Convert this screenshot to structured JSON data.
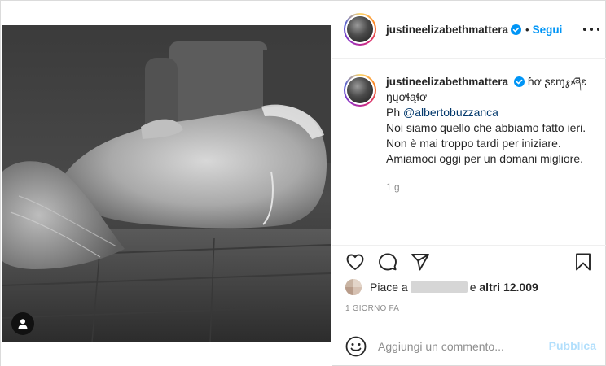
{
  "post": {
    "username": "justineelizabethmattera",
    "follow_label": "Segui",
    "separator": "•",
    "caption": {
      "title_text": "ɦơ ʂɛɱ℘ཞɛ ŋųơɬąɬơ",
      "photographer_prefix": "Ph ",
      "photographer_mention": "@albertobuzzanca",
      "line1": "Noi siamo quello che abbiamo fatto ieri.",
      "line2": "Non è mai troppo tardi per iniziare.",
      "line3": "Amiamoci oggi per un domani migliore.",
      "time_ago": "1 g"
    },
    "likes": {
      "prefix": "Piace a",
      "connector": "e",
      "others": "altri 12.009"
    },
    "date": "1 GIORNO FA",
    "comment": {
      "placeholder": "Aggiungi un commento...",
      "publish_label": "Pubblica"
    }
  },
  "colors": {
    "accent_blue": "#0095f6",
    "publish_disabled": "#b2dffc",
    "text_primary": "#262626",
    "text_secondary": "#8e8e8e",
    "mention": "#00376b"
  },
  "icons": {
    "verified": "verified-badge-icon",
    "more": "more-options-icon",
    "like": "heart-icon",
    "comment": "comment-bubble-icon",
    "share": "paper-plane-icon",
    "save": "bookmark-icon",
    "emoji": "emoji-icon",
    "tags": "user-tag-icon"
  }
}
